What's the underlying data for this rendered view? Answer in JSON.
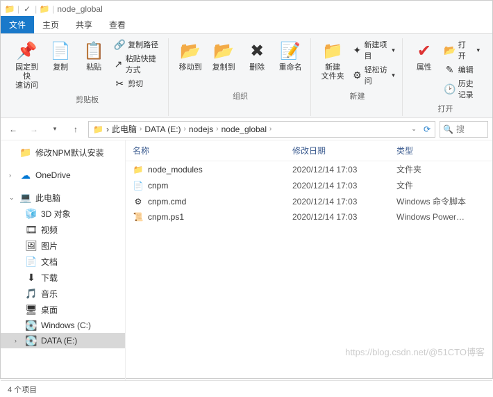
{
  "titlebar": {
    "title": "node_global"
  },
  "tabs": {
    "file": "文件",
    "home": "主页",
    "share": "共享",
    "view": "查看"
  },
  "ribbon": {
    "clipboard": {
      "pin": "固定到快\n速访问",
      "copy": "复制",
      "paste": "粘贴",
      "copypath": "复制路径",
      "pasteshortcut": "粘贴快捷方式",
      "cut": "剪切",
      "label": "剪贴板"
    },
    "organize": {
      "moveto": "移动到",
      "copyto": "复制到",
      "delete": "删除",
      "rename": "重命名",
      "label": "组织"
    },
    "new": {
      "newfolder": "新建\n文件夹",
      "newitem": "新建项目",
      "easyaccess": "轻松访问",
      "label": "新建"
    },
    "open": {
      "properties": "属性",
      "open": "打开",
      "edit": "编辑",
      "history": "历史记录",
      "label": "打开"
    }
  },
  "breadcrumbs": {
    "items": [
      "此电脑",
      "DATA (E:)",
      "nodejs",
      "node_global"
    ]
  },
  "search": {
    "placeholder": "搜"
  },
  "sidebar": {
    "npm": "修改NPM默认安装",
    "onedrive": "OneDrive",
    "thispc": "此电脑",
    "items": [
      {
        "icon": "3d",
        "label": "3D 对象"
      },
      {
        "icon": "video",
        "label": "视频"
      },
      {
        "icon": "pic",
        "label": "图片"
      },
      {
        "icon": "doc",
        "label": "文档"
      },
      {
        "icon": "dl",
        "label": "下载"
      },
      {
        "icon": "music",
        "label": "音乐"
      },
      {
        "icon": "desk",
        "label": "桌面"
      },
      {
        "icon": "drive",
        "label": "Windows (C:)"
      },
      {
        "icon": "drive",
        "label": "DATA (E:)"
      }
    ]
  },
  "files": {
    "headers": {
      "name": "名称",
      "date": "修改日期",
      "type": "类型"
    },
    "rows": [
      {
        "icon": "folder",
        "name": "node_modules",
        "date": "2020/12/14 17:03",
        "type": "文件夹"
      },
      {
        "icon": "file",
        "name": "cnpm",
        "date": "2020/12/14 17:03",
        "type": "文件"
      },
      {
        "icon": "cmd",
        "name": "cnpm.cmd",
        "date": "2020/12/14 17:03",
        "type": "Windows 命令脚本"
      },
      {
        "icon": "ps1",
        "name": "cnpm.ps1",
        "date": "2020/12/14 17:03",
        "type": "Windows Power…"
      }
    ]
  },
  "status": {
    "count": "4 个项目"
  },
  "watermark": "https://blog.csdn.net/@51CTO博客"
}
